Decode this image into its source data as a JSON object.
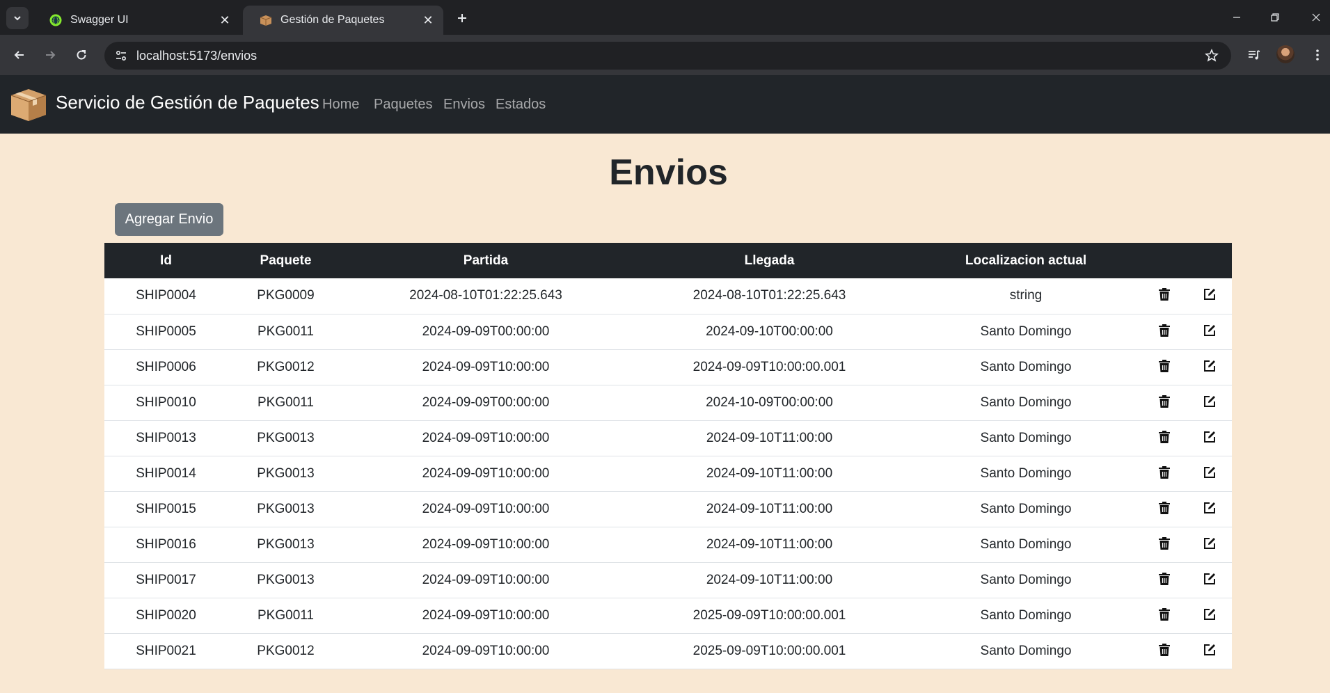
{
  "browser": {
    "tabs": [
      {
        "title": "Swagger UI",
        "active": false,
        "favicon": "swagger-icon"
      },
      {
        "title": "Gestión de Paquetes",
        "active": true,
        "favicon": "package-box-icon"
      }
    ],
    "url": "localhost:5173/envios"
  },
  "navbar": {
    "brand": "Servicio de Gestión de Paquetes",
    "links": [
      "Home",
      "Paquetes",
      "Envios",
      "Estados"
    ]
  },
  "page": {
    "title": "Envios",
    "add_button": "Agregar Envio"
  },
  "table": {
    "headers": [
      "Id",
      "Paquete",
      "Partida",
      "Llegada",
      "Localizacion actual"
    ],
    "rows": [
      {
        "id": "SHIP0004",
        "paquete": "PKG0009",
        "partida": "2024-08-10T01:22:25.643",
        "llegada": "2024-08-10T01:22:25.643",
        "localizacion": "string"
      },
      {
        "id": "SHIP0005",
        "paquete": "PKG0011",
        "partida": "2024-09-09T00:00:00",
        "llegada": "2024-09-10T00:00:00",
        "localizacion": "Santo Domingo"
      },
      {
        "id": "SHIP0006",
        "paquete": "PKG0012",
        "partida": "2024-09-09T10:00:00",
        "llegada": "2024-09-09T10:00:00.001",
        "localizacion": "Santo Domingo"
      },
      {
        "id": "SHIP0010",
        "paquete": "PKG0011",
        "partida": "2024-09-09T00:00:00",
        "llegada": "2024-10-09T00:00:00",
        "localizacion": "Santo Domingo"
      },
      {
        "id": "SHIP0013",
        "paquete": "PKG0013",
        "partida": "2024-09-09T10:00:00",
        "llegada": "2024-09-10T11:00:00",
        "localizacion": "Santo Domingo"
      },
      {
        "id": "SHIP0014",
        "paquete": "PKG0013",
        "partida": "2024-09-09T10:00:00",
        "llegada": "2024-09-10T11:00:00",
        "localizacion": "Santo Domingo"
      },
      {
        "id": "SHIP0015",
        "paquete": "PKG0013",
        "partida": "2024-09-09T10:00:00",
        "llegada": "2024-09-10T11:00:00",
        "localizacion": "Santo Domingo"
      },
      {
        "id": "SHIP0016",
        "paquete": "PKG0013",
        "partida": "2024-09-09T10:00:00",
        "llegada": "2024-09-10T11:00:00",
        "localizacion": "Santo Domingo"
      },
      {
        "id": "SHIP0017",
        "paquete": "PKG0013",
        "partida": "2024-09-09T10:00:00",
        "llegada": "2024-09-10T11:00:00",
        "localizacion": "Santo Domingo"
      },
      {
        "id": "SHIP0020",
        "paquete": "PKG0011",
        "partida": "2024-09-09T10:00:00",
        "llegada": "2025-09-09T10:00:00.001",
        "localizacion": "Santo Domingo"
      },
      {
        "id": "SHIP0021",
        "paquete": "PKG0012",
        "partida": "2024-09-09T10:00:00",
        "llegada": "2025-09-09T10:00:00.001",
        "localizacion": "Santo Domingo"
      }
    ]
  },
  "colors": {
    "page_bg": "#f9e8d3",
    "navbar_bg": "#212529",
    "table_header_bg": "#212529",
    "button_secondary": "#6c757d",
    "swagger_green": "#85ea2d"
  }
}
